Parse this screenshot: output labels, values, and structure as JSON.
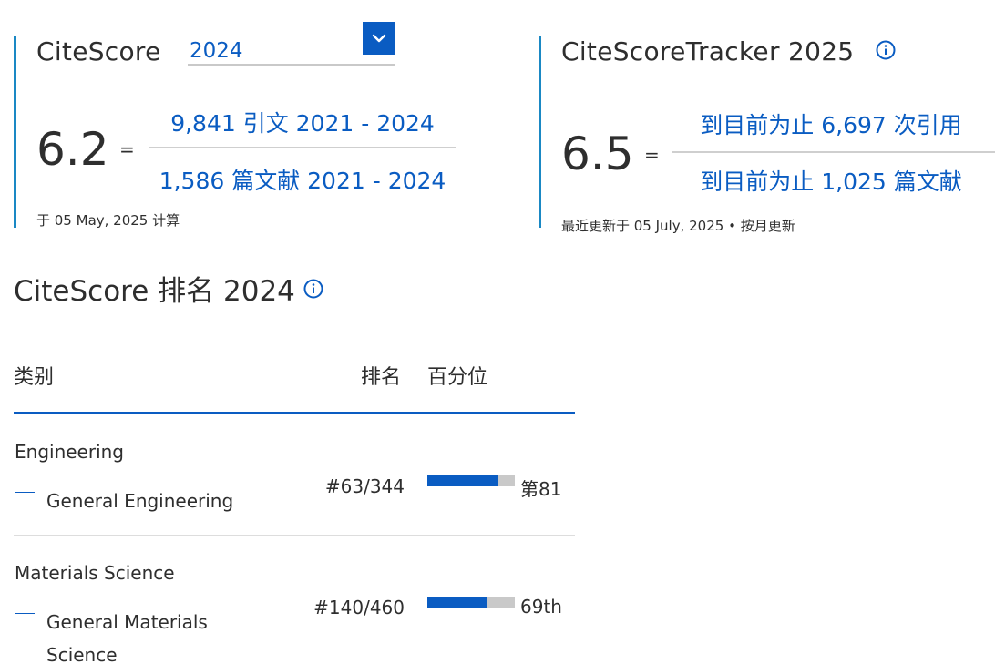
{
  "citescore": {
    "title": "CiteScore",
    "year_selected": "2024",
    "score": "6.2",
    "equals": "=",
    "numerator": "9,841 引文 2021 - 2024",
    "denominator": "1,586 篇文献 2021 - 2024",
    "calc_note": "于 05 May, 2025 计算"
  },
  "tracker": {
    "title": "CiteScoreTracker 2025",
    "score": "6.5",
    "equals": "=",
    "numerator": "到目前为止 6,697 次引用",
    "denominator": "到目前为止 1,025 篇文献",
    "update_note": "最近更新于 05 July, 2025 • 按月更新"
  },
  "ranking": {
    "title": "CiteScore 排名 2024",
    "headers": {
      "category": "类别",
      "rank": "排名",
      "percentile": "百分位"
    },
    "rows": [
      {
        "category": "Engineering",
        "subcategory": "General Engineering",
        "rank": "#63/344",
        "percentile_label": "第81",
        "percentile_value": 81
      },
      {
        "category": "Materials Science",
        "subcategory": "General Materials Science",
        "rank": "#140/460",
        "percentile_label": "69th",
        "percentile_value": 69
      }
    ]
  },
  "colors": {
    "accent": "#0a5cc2",
    "block_border": "#1a88c4",
    "bar_track": "#c9c9c9"
  },
  "icons": {
    "dropdown": "chevron-down-icon",
    "info": "info-icon"
  }
}
